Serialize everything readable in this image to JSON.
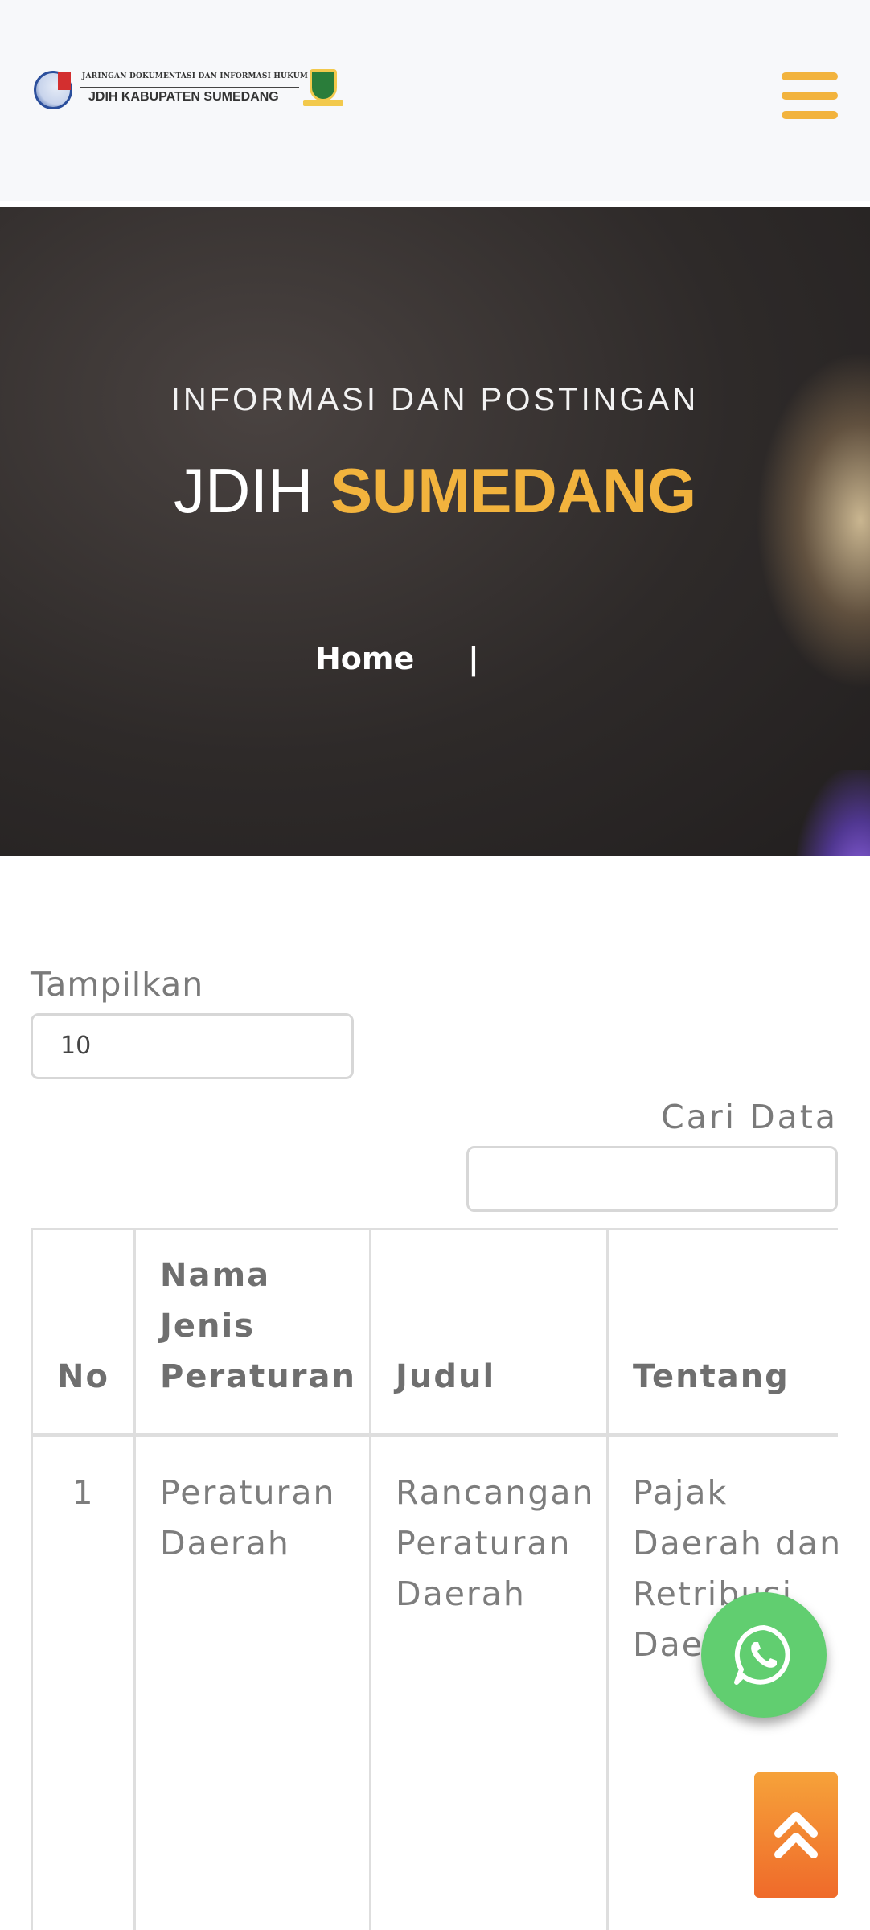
{
  "header": {
    "logo": {
      "small_text": "JARINGAN DOKUMENTASI DAN INFORMASI HUKUM",
      "big_text": "JDIH KABUPATEN SUMEDANG"
    },
    "menu_icon": "hamburger-menu-icon",
    "accent_color": "#f2b33d"
  },
  "hero": {
    "subtitle": "INFORMASI DAN POSTINGAN",
    "title_plain": "JDIH",
    "title_accent": "SUMEDANG",
    "breadcrumb": {
      "home": "Home",
      "separator": "|"
    }
  },
  "controls": {
    "show_label": "Tampilkan",
    "show_value": "10",
    "search_label": "Cari Data",
    "search_value": ""
  },
  "table": {
    "headers": [
      "No",
      "Nama Jenis Peraturan",
      "Judul",
      "Tentang"
    ],
    "rows": [
      [
        "1",
        "Peraturan Daerah",
        "Rancangan Peraturan Daerah",
        "Pajak Daerah dan Retribusi Daerah"
      ]
    ]
  },
  "floating": {
    "whatsapp_icon": "whatsapp-icon",
    "whatsapp_color": "#61ce70",
    "back_to_top_icon": "double-chevron-up-icon"
  }
}
